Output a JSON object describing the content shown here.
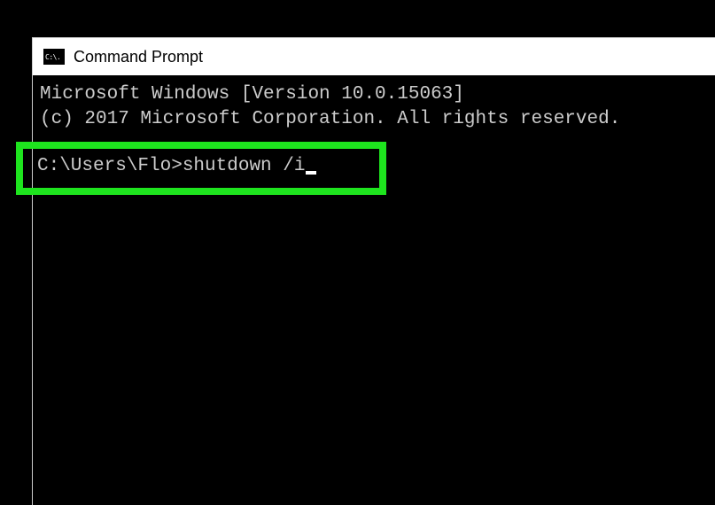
{
  "window": {
    "title": "Command Prompt",
    "icon_text": "C:\\."
  },
  "terminal": {
    "header_line_1": "Microsoft Windows [Version 10.0.15063]",
    "header_line_2": "(c) 2017 Microsoft Corporation. All rights reserved.",
    "prompt": "C:\\Users\\Flo>",
    "command": "shutdown /i"
  },
  "highlight": {
    "color": "#1ee41e"
  }
}
